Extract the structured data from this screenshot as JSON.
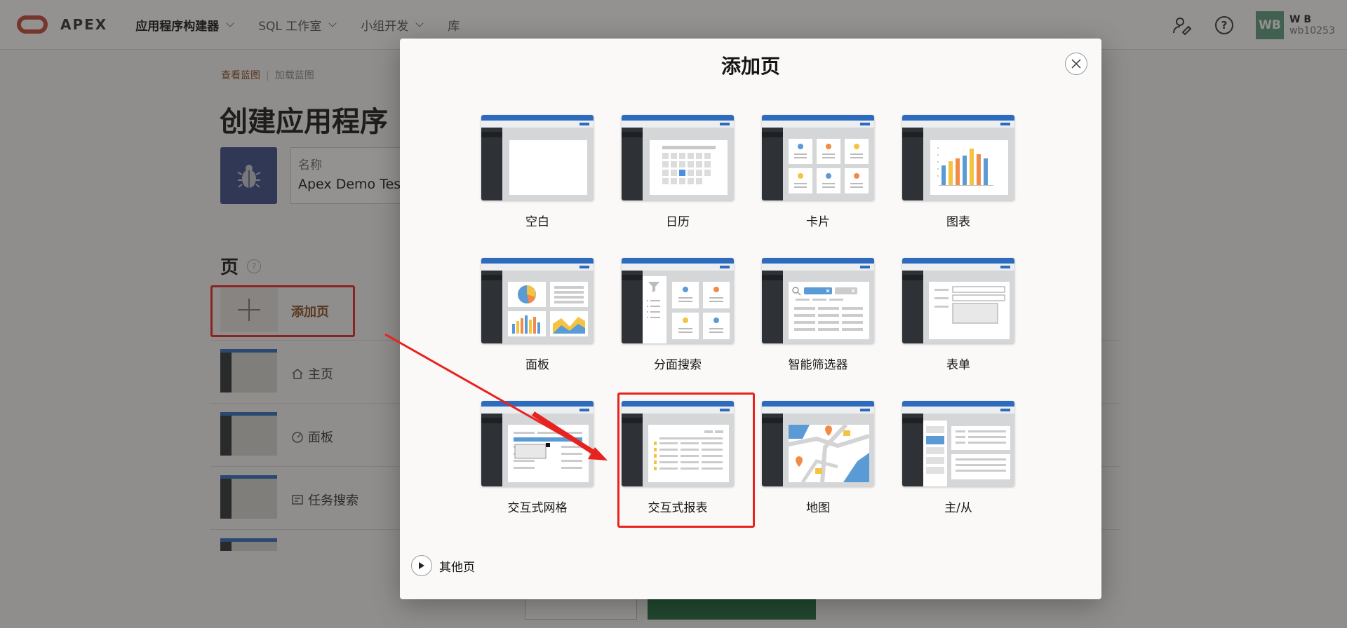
{
  "topbar": {
    "brand": "APEX",
    "nav": [
      {
        "label": "应用程序构建器",
        "active": true,
        "dropdown": true
      },
      {
        "label": "SQL 工作室",
        "active": false,
        "dropdown": true
      },
      {
        "label": "小组开发",
        "active": false,
        "dropdown": true
      },
      {
        "label": "库",
        "active": false,
        "dropdown": false
      }
    ],
    "avatar_initials": "WB",
    "user_name": "W B",
    "user_id": "wb10253"
  },
  "background": {
    "breadcrumb": [
      "查看蓝图",
      "加载蓝图"
    ],
    "page_title": "创建应用程序",
    "name_label": "名称",
    "name_value": "Apex Demo Test",
    "pages_heading": "页",
    "help_glyph": "?",
    "add_page_label": "添加页",
    "rows": [
      {
        "label": "主页",
        "icon": "home-icon"
      },
      {
        "label": "面板",
        "icon": "gauge-icon"
      },
      {
        "label": "任务搜索",
        "icon": "search-list-icon"
      }
    ]
  },
  "modal": {
    "title": "添加页",
    "tiles": [
      {
        "label": "空白",
        "icon": "blank-page-icon"
      },
      {
        "label": "日历",
        "icon": "calendar-page-icon"
      },
      {
        "label": "卡片",
        "icon": "cards-page-icon"
      },
      {
        "label": "图表",
        "icon": "chart-page-icon"
      },
      {
        "label": "面板",
        "icon": "dashboard-page-icon"
      },
      {
        "label": "分面搜索",
        "icon": "faceted-search-page-icon"
      },
      {
        "label": "智能筛选器",
        "icon": "smart-filters-page-icon"
      },
      {
        "label": "表单",
        "icon": "form-page-icon"
      },
      {
        "label": "交互式网格",
        "icon": "interactive-grid-page-icon"
      },
      {
        "label": "交互式报表",
        "icon": "interactive-report-page-icon"
      },
      {
        "label": "地图",
        "icon": "map-page-icon"
      },
      {
        "label": "主/从",
        "icon": "master-detail-page-icon"
      }
    ],
    "more_label": "其他页"
  },
  "colors": {
    "accent_blue": "#2d6bbf",
    "highlight_red": "#e8221f",
    "oracle_red": "#c74634",
    "link_brown": "#8a4b1e"
  }
}
